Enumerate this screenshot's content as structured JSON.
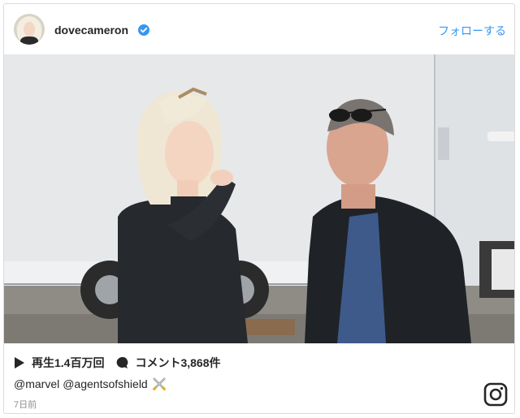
{
  "header": {
    "username": "dovecameron",
    "follow_label": "フォローする"
  },
  "stats": {
    "views": "再生1.4百万回",
    "comments": "コメント3,868件"
  },
  "caption": {
    "mention1": "@marvel",
    "mention2": "@agentsofshield"
  },
  "timestamp": "7日前",
  "icons": {
    "verified": "verified-badge-icon",
    "play": "play-icon",
    "comment": "comment-bubble-icon",
    "emoji": "crossed-swords-emoji-icon",
    "instagram": "instagram-logo-icon"
  },
  "colors": {
    "link": "#3897f0",
    "verified": "#3897f0",
    "muted": "#8e8e8e"
  }
}
